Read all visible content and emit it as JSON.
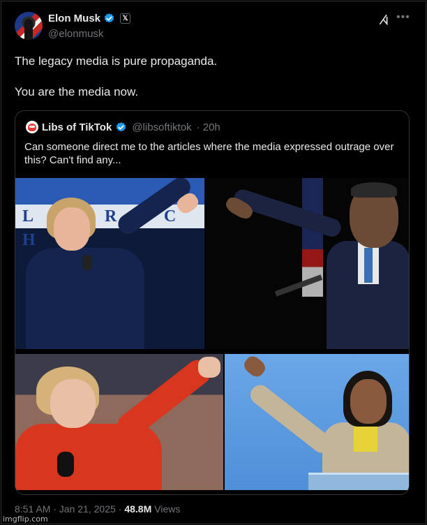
{
  "post": {
    "author_name": "Elon Musk",
    "author_handle": "@elonmusk",
    "text_line1": "The legacy media is pure propaganda.",
    "text_line2": "You are the media now.",
    "timestamp": "8:51 AM · Jan 21, 2025 ·",
    "views_count": "48.8M",
    "views_label": "Views"
  },
  "quoted": {
    "author_name": "Libs of TikTok",
    "author_handle": "@libsoftiktok",
    "age": "· 20h",
    "text": "Can someone direct me to the articles where the media expressed outrage over this? Can't find any...",
    "banner_text": "L I B R Y C H"
  },
  "icons": {
    "verified": "verified-badge-icon",
    "affiliate": "x-affiliate-icon",
    "grok": "grok-icon",
    "more": "more-icon"
  },
  "colors": {
    "background": "#000000",
    "text": "#e7e9ea",
    "secondary": "#71767b",
    "verified": "#1d9bf0",
    "border": "#2f3336"
  },
  "watermark": "imgflip.com"
}
